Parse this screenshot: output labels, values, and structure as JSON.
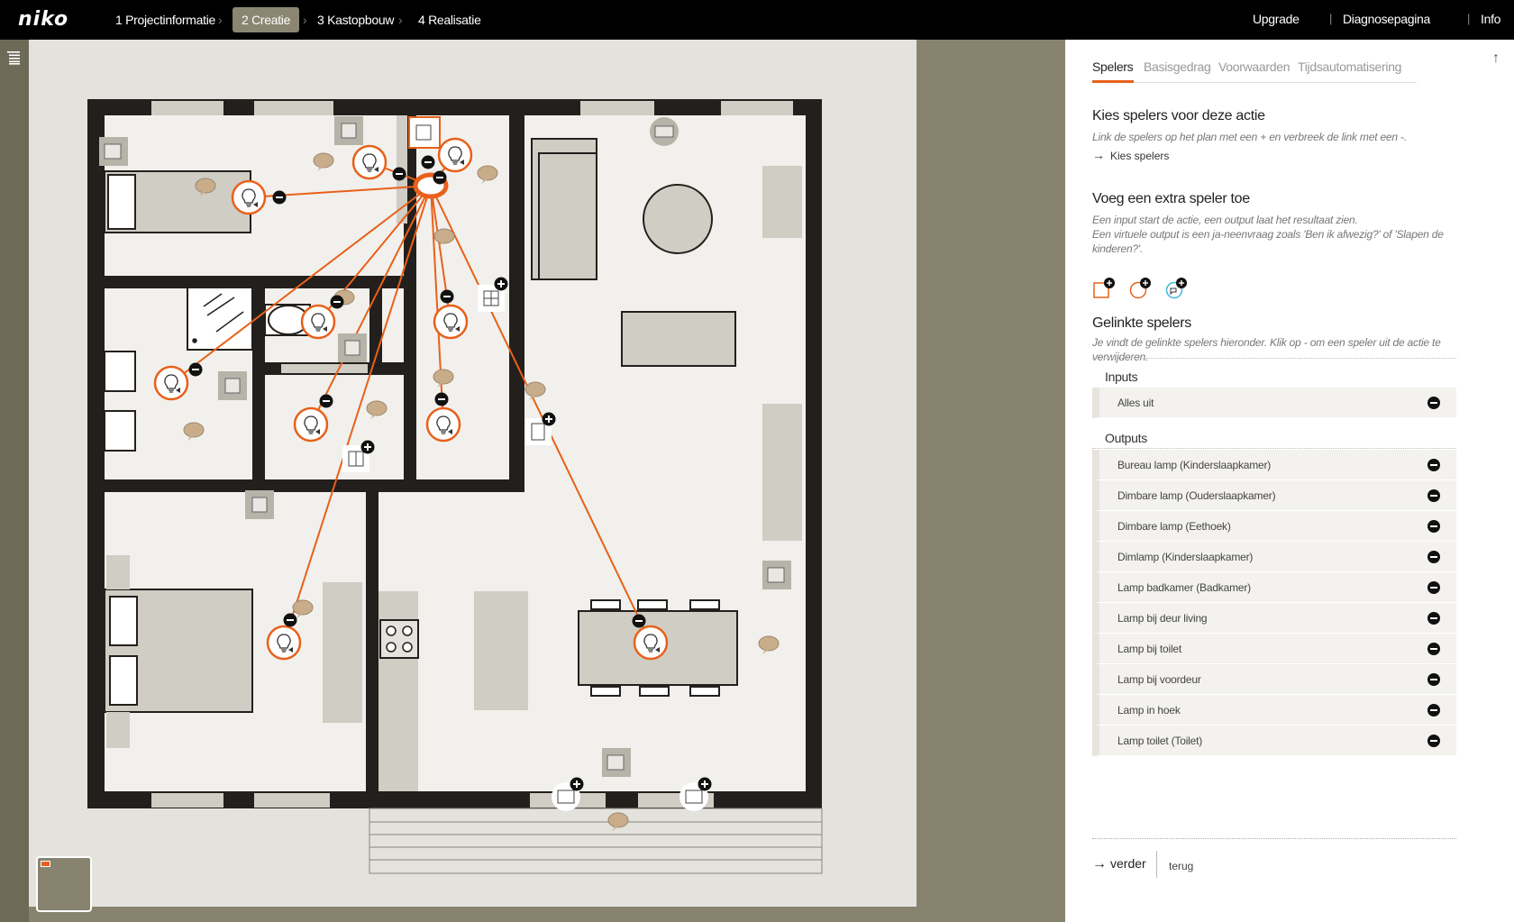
{
  "brand": {
    "logo": "niko",
    "accent": "#e8601a"
  },
  "steps": [
    {
      "label": "1 Projectinformatie"
    },
    {
      "label": "2 Creatie"
    },
    {
      "label": "3 Kastopbouw"
    },
    {
      "label": "4 Realisatie"
    }
  ],
  "active_step": 1,
  "top_links": {
    "upgrade": "Upgrade",
    "diagnose": "Diagnosepagina",
    "info": "Info"
  },
  "panel": {
    "tabs": [
      "Spelers",
      "Basisgedrag",
      "Voorwaarden",
      "Tijdsautomatisering"
    ],
    "active_tab": 0,
    "kies": {
      "title": "Kies spelers voor deze actie",
      "help": "Link de spelers op het plan met een + en verbreek de link met een -.",
      "link": "Kies spelers"
    },
    "extra": {
      "title": "Voeg een extra speler toe",
      "help1": "Een input start de actie, een output laat het resultaat zien.",
      "help2": "Een virtuele output is een ja-neenvraag zoals 'Ben ik afwezig?' of 'Slapen de kinderen?'.",
      "icons": [
        "add-input-icon",
        "add-output-icon",
        "add-virtual-output-icon"
      ]
    },
    "gelinkt": {
      "title": "Gelinkte spelers",
      "help": "Je vindt de gelinkte spelers hieronder. Klik op - om een speler uit de actie te verwijderen.",
      "inputs_label": "Inputs",
      "inputs": [
        "Alles uit"
      ],
      "outputs_label": "Outputs",
      "outputs": [
        "Bureau lamp (Kinderslaapkamer)",
        "Dimbare lamp (Ouderslaapkamer)",
        "Dimbare lamp (Eethoek)",
        "Dimlamp (Kinderslaapkamer)",
        "Lamp badkamer (Badkamer)",
        "Lamp bij deur living",
        "Lamp bij toilet",
        "Lamp bij voordeur",
        "Lamp in hoek",
        "Lamp toilet (Toilet)"
      ]
    },
    "footer": {
      "verder": "verder",
      "terug": "terug"
    }
  },
  "plan": {
    "link_color": "#e8601a",
    "furniture_color": "#cfcdc4",
    "wall_color": "#231f1c",
    "floor_color": "#f1f0ec"
  }
}
